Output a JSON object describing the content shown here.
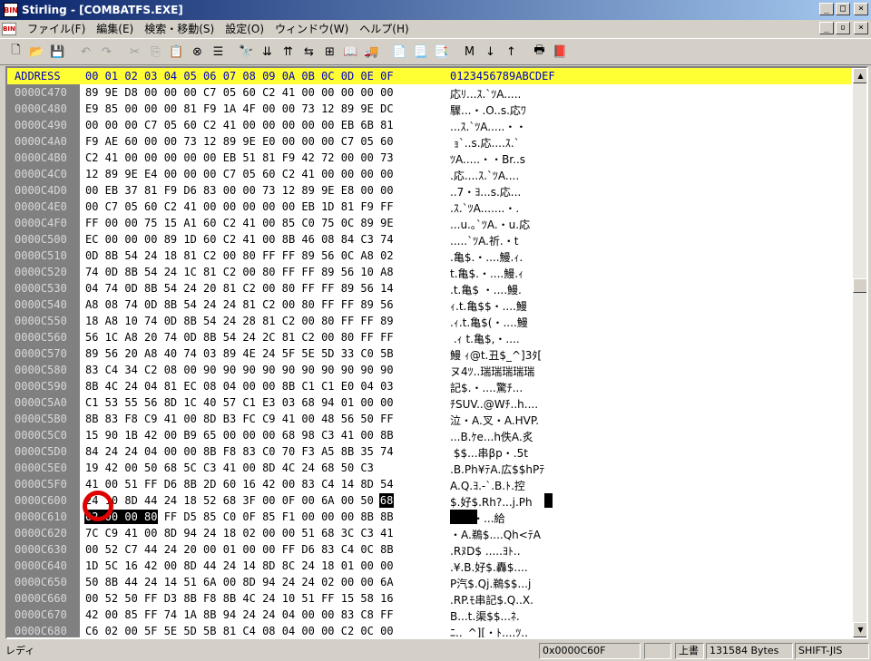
{
  "window": {
    "title": "Stirling - [COMBATFS.EXE]",
    "app_icon_text": "BIN",
    "controls": {
      "minimize": "_",
      "maximize": "□",
      "close": "×"
    },
    "mdi_controls": {
      "minimize": "_",
      "restore": "▫",
      "close": "×"
    }
  },
  "menu": [
    "ファイル(F)",
    "編集(E)",
    "検索・移動(S)",
    "設定(O)",
    "ウィンドウ(W)",
    "ヘルプ(H)"
  ],
  "toolbar": {
    "buttons": [
      {
        "name": "new-icon",
        "glyph": "🗋"
      },
      {
        "name": "open-icon",
        "glyph": "📂"
      },
      {
        "name": "save-icon",
        "glyph": "💾"
      },
      {
        "name": "undo-icon",
        "glyph": "↶",
        "disabled": true
      },
      {
        "name": "redo-icon",
        "glyph": "↷",
        "disabled": true
      },
      {
        "name": "cut-icon",
        "glyph": "✂",
        "disabled": true
      },
      {
        "name": "copy-icon",
        "glyph": "⎘",
        "disabled": true
      },
      {
        "name": "paste-icon",
        "glyph": "📋"
      },
      {
        "name": "delete-icon",
        "glyph": "⊗"
      },
      {
        "name": "list-icon",
        "glyph": "☰"
      },
      {
        "name": "find-icon",
        "glyph": "🔭"
      },
      {
        "name": "find-next-icon",
        "glyph": "⇊"
      },
      {
        "name": "find-prev-icon",
        "glyph": "⇈"
      },
      {
        "name": "replace-icon",
        "glyph": "⇆"
      },
      {
        "name": "compare-icon",
        "glyph": "⊞"
      },
      {
        "name": "book-icon",
        "glyph": "📖"
      },
      {
        "name": "goto-icon",
        "glyph": "🚚"
      },
      {
        "name": "insert-file-icon",
        "glyph": "📄"
      },
      {
        "name": "page-down-icon",
        "glyph": "📃"
      },
      {
        "name": "page-right-icon",
        "glyph": "📑"
      },
      {
        "name": "mark-icon",
        "glyph": "M"
      },
      {
        "name": "next-mark-icon",
        "glyph": "↓"
      },
      {
        "name": "prev-mark-icon",
        "glyph": "↑"
      },
      {
        "name": "print-icon",
        "glyph": "🖶"
      },
      {
        "name": "help-book-icon",
        "glyph": "📕"
      }
    ]
  },
  "editor": {
    "header": {
      "address": "ADDRESS",
      "hex": "00 01 02 03 04 05 06 07 08 09 0A 0B 0C 0D 0E 0F",
      "ascii": "0123456789ABCDEF"
    },
    "rows": [
      {
        "addr": "0000C470",
        "hex": "89 9E D8 00 00 00 C7 05 60 C2 41 00 00 00 00 00",
        "asc": "応ﾘ...ｽ.`ﾂA....."
      },
      {
        "addr": "0000C480",
        "hex": "E9 85 00 00 00 81 F9 1A 4F 00 00 73 12 89 9E DC",
        "asc": "驟...・.O..s.応ﾜ"
      },
      {
        "addr": "0000C490",
        "hex": "00 00 00 C7 05 60 C2 41 00 00 00 00 00 EB 6B 81",
        "asc": "...ｽ.`ﾂA.....・・"
      },
      {
        "addr": "0000C4A0",
        "hex": "F9 AE 60 00 00 73 12 89 9E E0 00 00 00 C7 05 60",
        "asc": " ｮ`..s.応....ｽ.`"
      },
      {
        "addr": "0000C4B0",
        "hex": "C2 41 00 00 00 00 00 EB 51 81 F9 42 72 00 00 73",
        "asc": "ﾂA.....・・Br..s"
      },
      {
        "addr": "0000C4C0",
        "hex": "12 89 9E E4 00 00 00 C7 05 60 C2 41 00 00 00 00",
        "asc": ".応....ｽ.`ﾂA...."
      },
      {
        "addr": "0000C4D0",
        "hex": "00 EB 37 81 F9 D6 83 00 00 73 12 89 9E E8 00 00",
        "asc": "..7・ﾖ...s.応..."
      },
      {
        "addr": "0000C4E0",
        "hex": "00 C7 05 60 C2 41 00 00 00 00 00 EB 1D 81 F9 FF",
        "asc": ".ｽ.`ﾂA.......・."
      },
      {
        "addr": "0000C4F0",
        "hex": "FF 00 00 75 15 A1 60 C2 41 00 85 C0 75 0C 89 9E",
        "asc": "...u.｡`ﾂA.・u.応"
      },
      {
        "addr": "0000C500",
        "hex": "EC 00 00 00 89 1D 60 C2 41 00 8B 46 08 84 C3 74",
        "asc": ".....`ﾂA.祈.・t"
      },
      {
        "addr": "0000C510",
        "hex": "0D 8B 54 24 18 81 C2 00 80 FF FF 89 56 0C A8 02",
        "asc": ".亀$.・....鰻.ｨ."
      },
      {
        "addr": "0000C520",
        "hex": "74 0D 8B 54 24 1C 81 C2 00 80 FF FF 89 56 10 A8",
        "asc": "t.亀$.・....鰻.ｨ"
      },
      {
        "addr": "0000C530",
        "hex": "04 74 0D 8B 54 24 20 81 C2 00 80 FF FF 89 56 14",
        "asc": ".t.亀$ ・....鰻."
      },
      {
        "addr": "0000C540",
        "hex": "A8 08 74 0D 8B 54 24 24 81 C2 00 80 FF FF 89 56",
        "asc": "ｨ.t.亀$$・....鰻"
      },
      {
        "addr": "0000C550",
        "hex": "18 A8 10 74 0D 8B 54 24 28 81 C2 00 80 FF FF 89",
        "asc": ".ｨ.t.亀$(・....鰻"
      },
      {
        "addr": "0000C560",
        "hex": "56 1C A8 20 74 0D 8B 54 24 2C 81 C2 00 80 FF FF",
        "asc": " .ｨ t.亀$,・...."
      },
      {
        "addr": "0000C570",
        "hex": "89 56 20 A8 40 74 03 89 4E 24 5F 5E 5D 33 C0 5B",
        "asc": "鰻 ｨ@t.丑$_^]3ﾀ["
      },
      {
        "addr": "0000C580",
        "hex": "83 C4 34 C2 08 00 90 90 90 90 90 90 90 90 90 90",
        "asc": "ヌ4ﾂ..瑞瑞瑞瑞瑞"
      },
      {
        "addr": "0000C590",
        "hex": "8B 4C 24 04 81 EC 08 04 00 00 8B C1 C1 E0 04 03",
        "asc": "記$.・....驚ﾁ..."
      },
      {
        "addr": "0000C5A0",
        "hex": "C1 53 55 56 8D 1C 40 57 C1 E3 03 68 94 01 00 00",
        "asc": "ﾁSUV..@Wﾁ..h...."
      },
      {
        "addr": "0000C5B0",
        "hex": "8B 83 F8 C9 41 00 8D B3 FC C9 41 00 48 56 50 FF",
        "asc": "泣・A.叉・A.HVP."
      },
      {
        "addr": "0000C5C0",
        "hex": "15 90 1B 42 00 B9 65 00 00 00 68 98 C3 41 00 8B",
        "asc": "...B.ｹe...h佚A.炙"
      },
      {
        "addr": "0000C5D0",
        "hex": "84 24 24 04 00 00 8B F8 83 C0 70 F3 A5 8B 35 74",
        "asc": " $$...串βp・.5t"
      },
      {
        "addr": "0000C5E0",
        "hex": "19 42 00 50 68 5C C3 41 00 8D 4C 24 68 50 C3",
        "asc": ".B.Ph¥ﾃA.広$$hPﾃ"
      },
      {
        "addr": "0000C5F0",
        "hex": "41 00 51 FF D6 8B 2D 60 16 42 00 83 C4 14 8D 54",
        "asc": "A.Q.ﾖ.-`.B.ﾄ.控"
      },
      {
        "addr": "0000C600",
        "hex": "24 10 8D 44 24 18 52 68 3F 00 0F 00 6A 00 50 68",
        "asc": "$.好$.Rh?...j.Ph"
      },
      {
        "addr": "0000C610",
        "hex": "02 00 00 80 FF D5 85 C0 0F 85 F1 00 00 00 8B 8B",
        "asc": "....ﾕ.・...給"
      },
      {
        "addr": "0000C620",
        "hex": "7C C9 41 00 8D 94 24 18 02 00 00 51 68 3C C3 41",
        "asc": "・A.鵜$....Qh<ﾃA"
      },
      {
        "addr": "0000C630",
        "hex": "00 52 C7 44 24 20 00 01 00 00 FF D6 83 C4 0C 8B",
        "asc": ".RﾇD$ .....ﾖﾄ.."
      },
      {
        "addr": "0000C640",
        "hex": "1D 5C 16 42 00 8D 44 24 14 8D 8C 24 18 01 00 00",
        "asc": ".¥.B.好$.轟$...."
      },
      {
        "addr": "0000C650",
        "hex": "50 8B 44 24 14 51 6A 00 8D 94 24 24 02 00 00 6A",
        "asc": "P汽$.Qj.鵜$$...j"
      },
      {
        "addr": "0000C660",
        "hex": "00 52 50 FF D3 8B F8 8B 4C 24 10 51 FF 15 58 16",
        "asc": ".RP.ﾓ串記$.Q..X."
      },
      {
        "addr": "0000C670",
        "hex": "42 00 85 FF 74 1A 8B 94 24 24 04 00 00 83 C8 FF",
        "asc": "B...t.渠$$...ﾈ."
      },
      {
        "addr": "0000C680",
        "hex": "C6 02 00 5F 5E 5D 5B 81 C4 08 04 00 00 C2 0C 00",
        "asc": "ﾆ.._^][・ﾄ....ﾂ.."
      }
    ]
  },
  "status": {
    "left": "レディ",
    "offset": "0x0000C60F",
    "mode": "上書",
    "size": "131584 Bytes",
    "encoding": "SHIFT-JIS"
  },
  "colors": {
    "header_bg": "#ffff33",
    "address_bg": "#808080",
    "highlight": "#000000",
    "marker": "#e00000"
  }
}
